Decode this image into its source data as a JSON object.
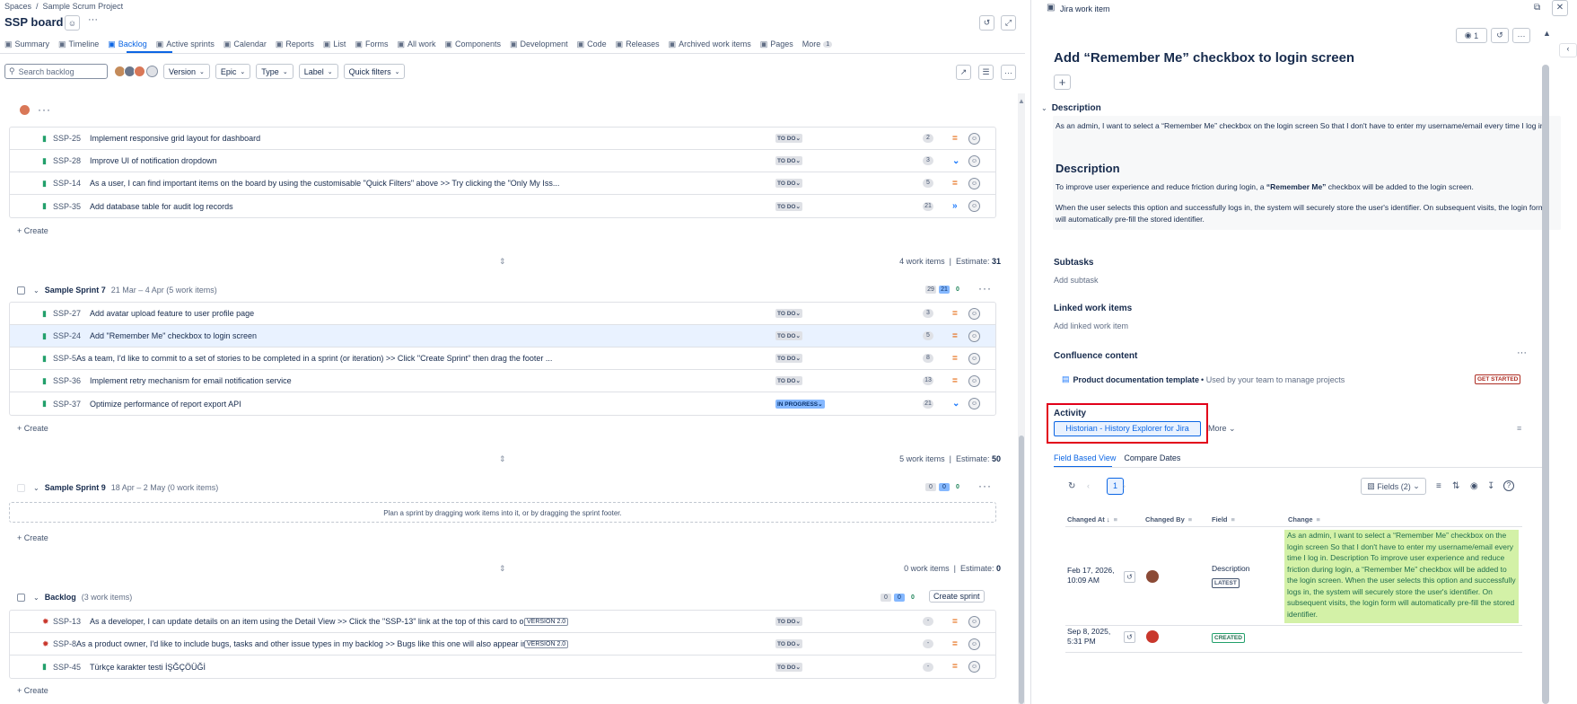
{
  "breadcrumb": {
    "spaces": "Spaces",
    "sep": "/",
    "project": "Sample Scrum Project"
  },
  "board_title": "SSP board",
  "tabs": [
    {
      "icon": "globe-icon",
      "label": "Summary"
    },
    {
      "icon": "timeline-icon",
      "label": "Timeline"
    },
    {
      "icon": "backlog-icon",
      "label": "Backlog",
      "active": true
    },
    {
      "icon": "board-icon",
      "label": "Active sprints"
    },
    {
      "icon": "calendar-icon",
      "label": "Calendar"
    },
    {
      "icon": "reports-icon",
      "label": "Reports"
    },
    {
      "icon": "list-icon",
      "label": "List"
    },
    {
      "icon": "forms-icon",
      "label": "Forms"
    },
    {
      "icon": "allwork-icon",
      "label": "All work"
    },
    {
      "icon": "components-icon",
      "label": "Components"
    },
    {
      "icon": "code-icon",
      "label": "Development"
    },
    {
      "icon": "code-icon",
      "label": "Code"
    },
    {
      "icon": "releases-icon",
      "label": "Releases"
    },
    {
      "icon": "archive-icon",
      "label": "Archived work items"
    },
    {
      "icon": "pages-icon",
      "label": "Pages"
    },
    {
      "icon": "",
      "label": "More"
    }
  ],
  "more_count": "1",
  "toolbar": {
    "search_placeholder": "Search backlog",
    "filters": [
      "Version",
      "Epic",
      "Type",
      "Label",
      "Quick filters"
    ]
  },
  "sprint_a": {
    "rows": [
      {
        "key": "SSP-25",
        "summary": "Implement responsive grid layout for dashboard",
        "status": "TO DO",
        "estimate": "2",
        "priority": "medium"
      },
      {
        "key": "SSP-28",
        "summary": "Improve UI of notification dropdown",
        "status": "TO DO",
        "estimate": "3",
        "priority": "low"
      },
      {
        "key": "SSP-14",
        "summary": "As a user, I can find important items on the board by using the customisable \"Quick Filters\" above >> Try clicking the \"Only My Iss...",
        "status": "TO DO",
        "estimate": "5",
        "priority": "medium"
      },
      {
        "key": "SSP-35",
        "summary": "Add database table for audit log records",
        "status": "TO DO",
        "estimate": "21",
        "priority": "lowest"
      }
    ],
    "create": "Create",
    "summary_count": "4 work items",
    "summary_estimate_label": "Estimate:",
    "summary_estimate": "31"
  },
  "sprint_7": {
    "name": "Sample Sprint 7",
    "dates": "21 Mar – 4 Apr (5 work items)",
    "counts": [
      "29",
      "21",
      "0"
    ],
    "rows": [
      {
        "key": "SSP-27",
        "summary": "Add avatar upload feature to user profile page",
        "status": "TO DO",
        "estimate": "3",
        "priority": "medium"
      },
      {
        "key": "SSP-24",
        "summary": "Add \"Remember Me\" checkbox to login screen",
        "status": "TO DO",
        "estimate": "5",
        "priority": "medium",
        "selected": true
      },
      {
        "key": "SSP-5",
        "summary": "As a team, I'd like to commit to a set of stories to be completed in a sprint (or iteration) >> Click \"Create Sprint\" then drag the footer ...",
        "status": "TO DO",
        "estimate": "8",
        "priority": "medium"
      },
      {
        "key": "SSP-36",
        "summary": "Implement retry mechanism for email notification service",
        "status": "TO DO",
        "estimate": "13",
        "priority": "medium"
      },
      {
        "key": "SSP-37",
        "summary": "Optimize performance of report export API",
        "status": "IN PROGRESS",
        "estimate": "21",
        "priority": "low"
      }
    ],
    "create": "Create",
    "summary_count": "5 work items",
    "summary_estimate_label": "Estimate:",
    "summary_estimate": "50"
  },
  "sprint_9": {
    "name": "Sample Sprint 9",
    "dates": "18 Apr – 2 May (0 work items)",
    "counts": [
      "0",
      "0",
      "0"
    ],
    "empty_text": "Plan a sprint by dragging work items into it, or by dragging the sprint footer.",
    "create": "Create",
    "summary_count": "0 work items",
    "summary_estimate_label": "Estimate:",
    "summary_estimate": "0"
  },
  "backlog": {
    "name": "Backlog",
    "dates": "(3 work items)",
    "counts": [
      "0",
      "0",
      "0"
    ],
    "create_sprint": "Create sprint",
    "rows": [
      {
        "key": "SSP-13",
        "type": "bug",
        "summary": "As a developer, I can update details on an item using the Detail View >> Click the \"SSP-13\" link at the top of this card to open the d...",
        "version": "VERSION 2.0",
        "status": "TO DO",
        "estimate": "-",
        "priority": "medium"
      },
      {
        "key": "SSP-8",
        "type": "bug",
        "summary": "As a product owner, I'd like to include bugs, tasks and other issue types in my backlog >> Bugs like this one will also appear in your ...",
        "version": "VERSION 2.0",
        "status": "TO DO",
        "estimate": "-",
        "priority": "medium"
      },
      {
        "key": "SSP-45",
        "type": "story",
        "summary": "Türkçe karakter testi İŞĞÇÖÜĞİ",
        "status": "TO DO",
        "estimate": "-",
        "priority": "medium"
      }
    ],
    "create": "Create"
  },
  "panel": {
    "header": "Jira work item",
    "watch_count": "1",
    "title": "Add “Remember Me” checkbox to login screen",
    "description_label": "Description",
    "desc_p1": "As an admin, I want to select a “Remember Me” checkbox on the login screen So that I don't have to enter my username/email every time I log in.",
    "desc_h2": "Description",
    "desc_p2_a": "To improve user experience and reduce friction during login, a ",
    "desc_p2_b": "“Remember Me”",
    "desc_p2_c": " checkbox will be added to the login screen.",
    "desc_p3": "When the user selects this option and successfully logs in, the system will securely store the user's identifier. On subsequent visits, the login form will automatically pre-fill the stored identifier.",
    "subtasks_label": "Subtasks",
    "add_subtask": "Add subtask",
    "linked_label": "Linked work items",
    "add_linked": "Add linked work item",
    "confluence_label": "Confluence content",
    "conf_title": "Product documentation template",
    "conf_sep": "•",
    "conf_desc": "Used by your team to manage projects",
    "get_started": "GET STARTED",
    "activity_label": "Activity",
    "historian_button": "Historian - History Explorer for Jira",
    "more_label": "More",
    "tab_field": "Field Based View",
    "tab_compare": "Compare Dates",
    "page": "1",
    "fields_button": "Fields (2)",
    "columns": {
      "changed_at": "Changed At",
      "changed_by": "Changed By",
      "field": "Field",
      "change": "Change"
    },
    "history": [
      {
        "date": "Feb 17, 2026,",
        "time": "10:09 AM",
        "field": "Description",
        "badge": "LATEST",
        "change": "As an admin, I want to select a “Remember Me” checkbox on the login screen So that I don't have to enter my username/email every time I log in. Description To improve user experience and reduce friction during login, a “Remember Me” checkbox will be added to the login screen. When the user selects this option and successfully logs in, the system will securely store the user's identifier. On subsequent visits, the login form will automatically pre-fill the stored identifier."
      },
      {
        "date": "Sep 8, 2025,",
        "time": "5:31 PM",
        "field": "",
        "badge": "CREATED",
        "change": ""
      }
    ]
  }
}
